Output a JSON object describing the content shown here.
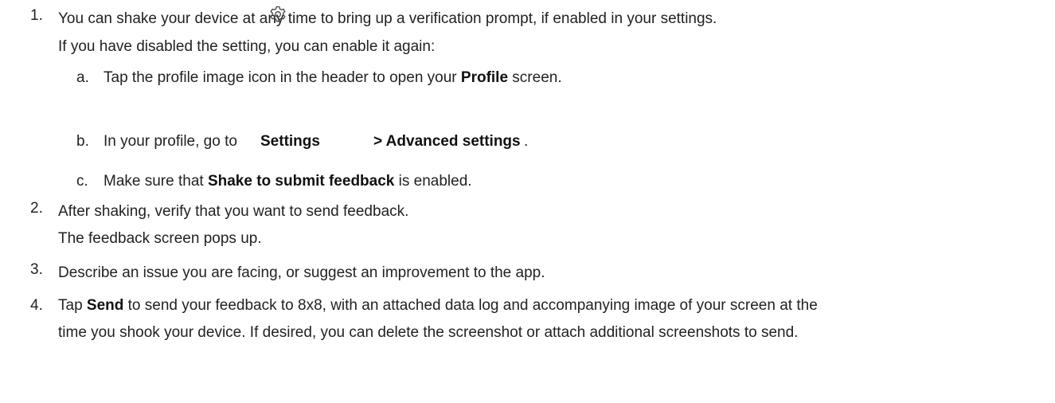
{
  "steps": {
    "s1": {
      "number": "1.",
      "line1": "You can shake your device at any time to bring up a verification prompt, if enabled in your settings.",
      "line2": "If you have disabled the setting, you can enable it again:",
      "substeps": {
        "a": {
          "letter": "a.",
          "pre": "Tap the profile image icon in the header to open your ",
          "bold": "Profile",
          "post": " screen."
        },
        "b": {
          "letter": "b.",
          "pre": "In your profile, go to ",
          "bold1": "Settings",
          "icon": "gear-icon",
          "bold2": "> Advanced settings",
          "post": "."
        },
        "c": {
          "letter": "c.",
          "pre": "Make sure that ",
          "bold": "Shake to submit feedback",
          "post": " is enabled."
        }
      }
    },
    "s2": {
      "number": "2.",
      "line1": "After shaking, verify that you want to send feedback.",
      "line2": "The feedback screen pops up."
    },
    "s3": {
      "number": "3.",
      "line1": "Describe an issue you are facing, or suggest an improvement to the app."
    },
    "s4": {
      "number": "4.",
      "pre": "Tap ",
      "bold": "Send",
      "post": " to send your feedback to 8x8, with an attached data log and accompanying image of your screen at the",
      "line2": "time you shook your device. If desired, you can delete the screenshot or attach additional screenshots to send."
    }
  }
}
